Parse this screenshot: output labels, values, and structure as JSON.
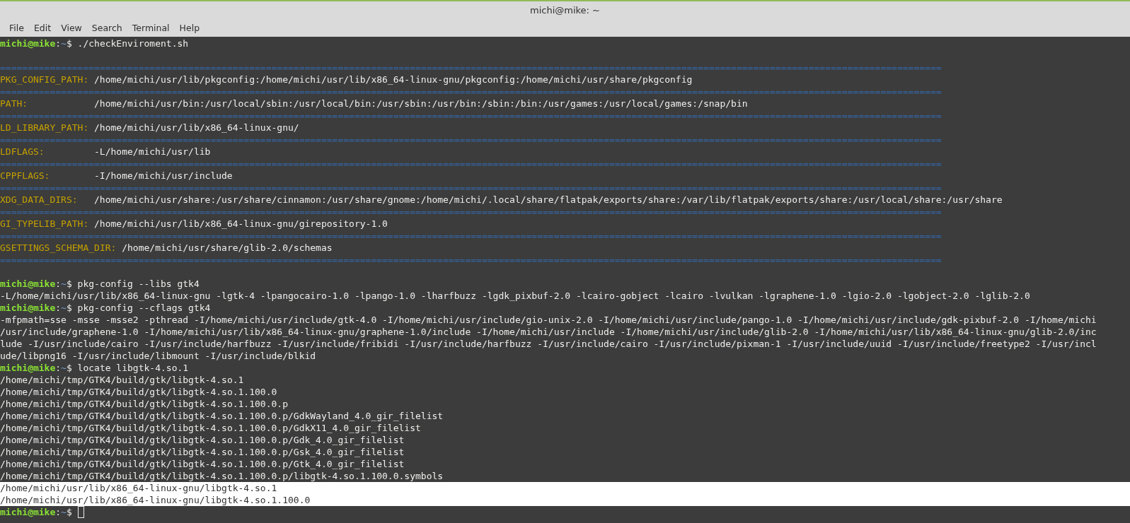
{
  "window": {
    "title": "michi@mike: ~"
  },
  "menu": [
    {
      "label": "File"
    },
    {
      "label": "Edit"
    },
    {
      "label": "View"
    },
    {
      "label": "Search"
    },
    {
      "label": "Terminal"
    },
    {
      "label": "Help"
    }
  ],
  "terminal": {
    "lines": [
      {
        "kind": "prompt",
        "user": "michi@mike",
        "colon": ":",
        "cwd": "~",
        "sigil": "$",
        "command": "./checkEnviroment.sh",
        "cursor": false
      },
      {
        "kind": "blank"
      },
      {
        "kind": "separator",
        "text": "=========================================================================================================================================================================="
      },
      {
        "kind": "var",
        "name": "PKG_CONFIG_PATH:",
        "value": "/home/michi/usr/lib/pkgconfig:/home/michi/usr/lib/x86_64-linux-gnu/pkgconfig:/home/michi/usr/share/pkgconfig"
      },
      {
        "kind": "separator",
        "text": "=========================================================================================================================================================================="
      },
      {
        "kind": "var",
        "name": "PATH:",
        "value": "/home/michi/usr/bin:/usr/local/sbin:/usr/local/bin:/usr/sbin:/usr/bin:/sbin:/bin:/usr/games:/usr/local/games:/snap/bin"
      },
      {
        "kind": "separator",
        "text": "=========================================================================================================================================================================="
      },
      {
        "kind": "var",
        "name": "LD_LIBRARY_PATH:",
        "value": "/home/michi/usr/lib/x86_64-linux-gnu/"
      },
      {
        "kind": "separator",
        "text": "=========================================================================================================================================================================="
      },
      {
        "kind": "var",
        "name": "LDFLAGS:",
        "value": "-L/home/michi/usr/lib"
      },
      {
        "kind": "separator",
        "text": "=========================================================================================================================================================================="
      },
      {
        "kind": "var",
        "name": "CPPFLAGS:",
        "value": "-I/home/michi/usr/include"
      },
      {
        "kind": "separator",
        "text": "=========================================================================================================================================================================="
      },
      {
        "kind": "var",
        "name": "XDG_DATA_DIRS:",
        "value": "/home/michi/usr/share:/usr/share/cinnamon:/usr/share/gnome:/home/michi/.local/share/flatpak/exports/share:/var/lib/flatpak/exports/share:/usr/local/share:/usr/share"
      },
      {
        "kind": "separator",
        "text": "=========================================================================================================================================================================="
      },
      {
        "kind": "var",
        "name": "GI_TYPELIB_PATH:",
        "value": "/home/michi/usr/lib/x86_64-linux-gnu/girepository-1.0"
      },
      {
        "kind": "separator",
        "text": "=========================================================================================================================================================================="
      },
      {
        "kind": "var",
        "name": "GSETTINGS_SCHEMA_DIR:",
        "value": "/home/michi/usr/share/glib-2.0/schemas"
      },
      {
        "kind": "separator",
        "text": "=========================================================================================================================================================================="
      },
      {
        "kind": "blank"
      },
      {
        "kind": "prompt",
        "user": "michi@mike",
        "colon": ":",
        "cwd": "~",
        "sigil": "$",
        "command": "pkg-config --libs gtk4",
        "cursor": false
      },
      {
        "kind": "output",
        "text": "-L/home/michi/usr/lib/x86_64-linux-gnu -lgtk-4 -lpangocairo-1.0 -lpango-1.0 -lharfbuzz -lgdk_pixbuf-2.0 -lcairo-gobject -lcairo -lvulkan -lgraphene-1.0 -lgio-2.0 -lgobject-2.0 -lglib-2.0",
        "selected": false
      },
      {
        "kind": "prompt",
        "user": "michi@mike",
        "colon": ":",
        "cwd": "~",
        "sigil": "$",
        "command": "pkg-config --cflags gtk4",
        "cursor": false
      },
      {
        "kind": "output",
        "text": "-mfpmath=sse -msse -msse2 -pthread -I/home/michi/usr/include/gtk-4.0 -I/home/michi/usr/include/gio-unix-2.0 -I/home/michi/usr/include/pango-1.0 -I/home/michi/usr/include/gdk-pixbuf-2.0 -I/home/michi",
        "selected": false
      },
      {
        "kind": "output",
        "text": "/usr/include/graphene-1.0 -I/home/michi/usr/lib/x86_64-linux-gnu/graphene-1.0/include -I/home/michi/usr/include -I/home/michi/usr/include/glib-2.0 -I/home/michi/usr/lib/x86_64-linux-gnu/glib-2.0/inc",
        "selected": false
      },
      {
        "kind": "output",
        "text": "lude -I/usr/include/cairo -I/usr/include/harfbuzz -I/usr/include/fribidi -I/usr/include/harfbuzz -I/usr/include/cairo -I/usr/include/pixman-1 -I/usr/include/uuid -I/usr/include/freetype2 -I/usr/incl",
        "selected": false
      },
      {
        "kind": "output",
        "text": "ude/libpng16 -I/usr/include/libmount -I/usr/include/blkid",
        "selected": false
      },
      {
        "kind": "prompt",
        "user": "michi@mike",
        "colon": ":",
        "cwd": "~",
        "sigil": "$",
        "command": "locate libgtk-4.so.1",
        "cursor": false
      },
      {
        "kind": "output",
        "text": "/home/michi/tmp/GTK4/build/gtk/libgtk-4.so.1",
        "selected": false
      },
      {
        "kind": "output",
        "text": "/home/michi/tmp/GTK4/build/gtk/libgtk-4.so.1.100.0",
        "selected": false
      },
      {
        "kind": "output",
        "text": "/home/michi/tmp/GTK4/build/gtk/libgtk-4.so.1.100.0.p",
        "selected": false
      },
      {
        "kind": "output",
        "text": "/home/michi/tmp/GTK4/build/gtk/libgtk-4.so.1.100.0.p/GdkWayland_4.0_gir_filelist",
        "selected": false
      },
      {
        "kind": "output",
        "text": "/home/michi/tmp/GTK4/build/gtk/libgtk-4.so.1.100.0.p/GdkX11_4.0_gir_filelist",
        "selected": false
      },
      {
        "kind": "output",
        "text": "/home/michi/tmp/GTK4/build/gtk/libgtk-4.so.1.100.0.p/Gdk_4.0_gir_filelist",
        "selected": false
      },
      {
        "kind": "output",
        "text": "/home/michi/tmp/GTK4/build/gtk/libgtk-4.so.1.100.0.p/Gsk_4.0_gir_filelist",
        "selected": false
      },
      {
        "kind": "output",
        "text": "/home/michi/tmp/GTK4/build/gtk/libgtk-4.so.1.100.0.p/Gtk_4.0_gir_filelist",
        "selected": false
      },
      {
        "kind": "output",
        "text": "/home/michi/tmp/GTK4/build/gtk/libgtk-4.so.1.100.0.p/libgtk-4.so.1.100.0.symbols",
        "selected": false
      },
      {
        "kind": "output",
        "text": "/home/michi/usr/lib/x86_64-linux-gnu/libgtk-4.so.1",
        "selected": true
      },
      {
        "kind": "output",
        "text": "/home/michi/usr/lib/x86_64-linux-gnu/libgtk-4.so.1.100.0",
        "selected": true
      },
      {
        "kind": "prompt",
        "user": "michi@mike",
        "colon": ":",
        "cwd": "~",
        "sigil": "$",
        "cursor": true
      }
    ]
  }
}
